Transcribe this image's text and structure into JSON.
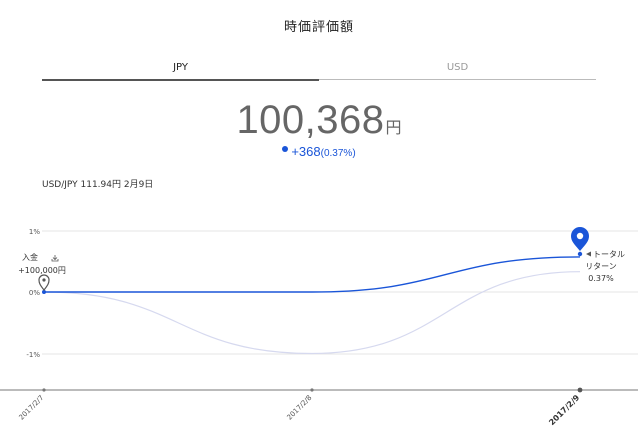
{
  "header": {
    "title": "時価評価額"
  },
  "tabs": [
    {
      "label": "JPY",
      "active": true
    },
    {
      "label": "USD",
      "active": false
    }
  ],
  "valuation": {
    "amount": "100,368",
    "unit": "円",
    "change": "+368",
    "change_pct": "(0.37%)"
  },
  "rate_text": "USD/JPY 111.94円 2月9日",
  "deposit": {
    "label": "入金",
    "amount": "+100,000円"
  },
  "total_return": {
    "label_line1": "トータル",
    "label_line2": "リターン",
    "value": "0.37%"
  },
  "colors": {
    "accent": "#1a55d8",
    "secondary_line": "#d6d9ef",
    "grid": "#e6e6e6"
  },
  "chart_data": {
    "type": "line",
    "x": [
      "2017/2/7",
      "2017/2/8",
      "2017/2/9"
    ],
    "yticks": [
      "1%",
      "0%",
      "-1%"
    ],
    "ylim": [
      -1.5,
      1.2
    ],
    "series": [
      {
        "values": [
          0,
          0,
          0.57
        ]
      },
      {
        "values": [
          0,
          -1.0,
          0.33
        ]
      }
    ]
  }
}
